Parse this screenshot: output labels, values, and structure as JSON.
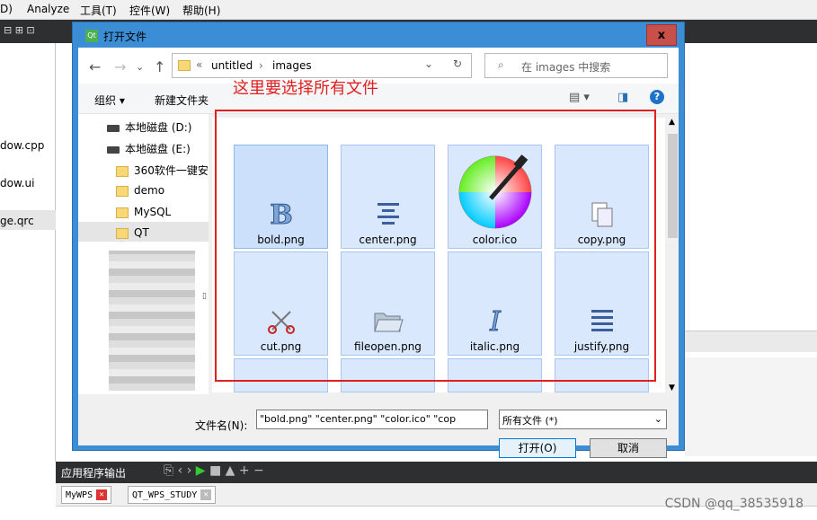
{
  "menubar": {
    "items": [
      "D)",
      "Analyze",
      "工具(T)",
      "控件(W)",
      "帮助(H)"
    ]
  },
  "left_pane": {
    "items": [
      "dow.cpp",
      "dow.ui",
      "ge.qrc"
    ]
  },
  "dialog": {
    "title": "打开文件",
    "close": "x",
    "breadcrumb": {
      "prefix": "«",
      "parts": [
        "untitled",
        "images"
      ]
    },
    "search_placeholder": "在 images 中搜索",
    "organize": "组织 ▾",
    "new_folder": "新建文件夹",
    "tree": [
      {
        "label": "本地磁盘 (D:)",
        "type": "drive"
      },
      {
        "label": "本地磁盘 (E:)",
        "type": "drive"
      },
      {
        "label": "360软件一键安",
        "type": "folder"
      },
      {
        "label": "demo",
        "type": "folder"
      },
      {
        "label": "MySQL",
        "type": "folder"
      },
      {
        "label": "QT",
        "type": "folder"
      }
    ],
    "files": [
      "bold.png",
      "center.png",
      "color.ico",
      "copy.png",
      "cut.png",
      "fileopen.png",
      "italic.png",
      "justify.png"
    ],
    "filename_label": "文件名(N):",
    "filename_value": "\"bold.png\" \"center.png\" \"color.ico\" \"cop",
    "filetype_value": "所有文件 (*)",
    "open_button": "打开(O)",
    "cancel_button": "取消"
  },
  "annotation": "这里要选择所有文件",
  "bottom": {
    "output_label": "应用程序输出",
    "tabs": [
      "MyWPS",
      "QT_WPS_STUDY"
    ]
  },
  "watermark": "CSDN @qq_38535918",
  "colors": {
    "accent": "#3b8ed6",
    "annotation": "#e02020",
    "ide_dark": "#2e2f30"
  }
}
